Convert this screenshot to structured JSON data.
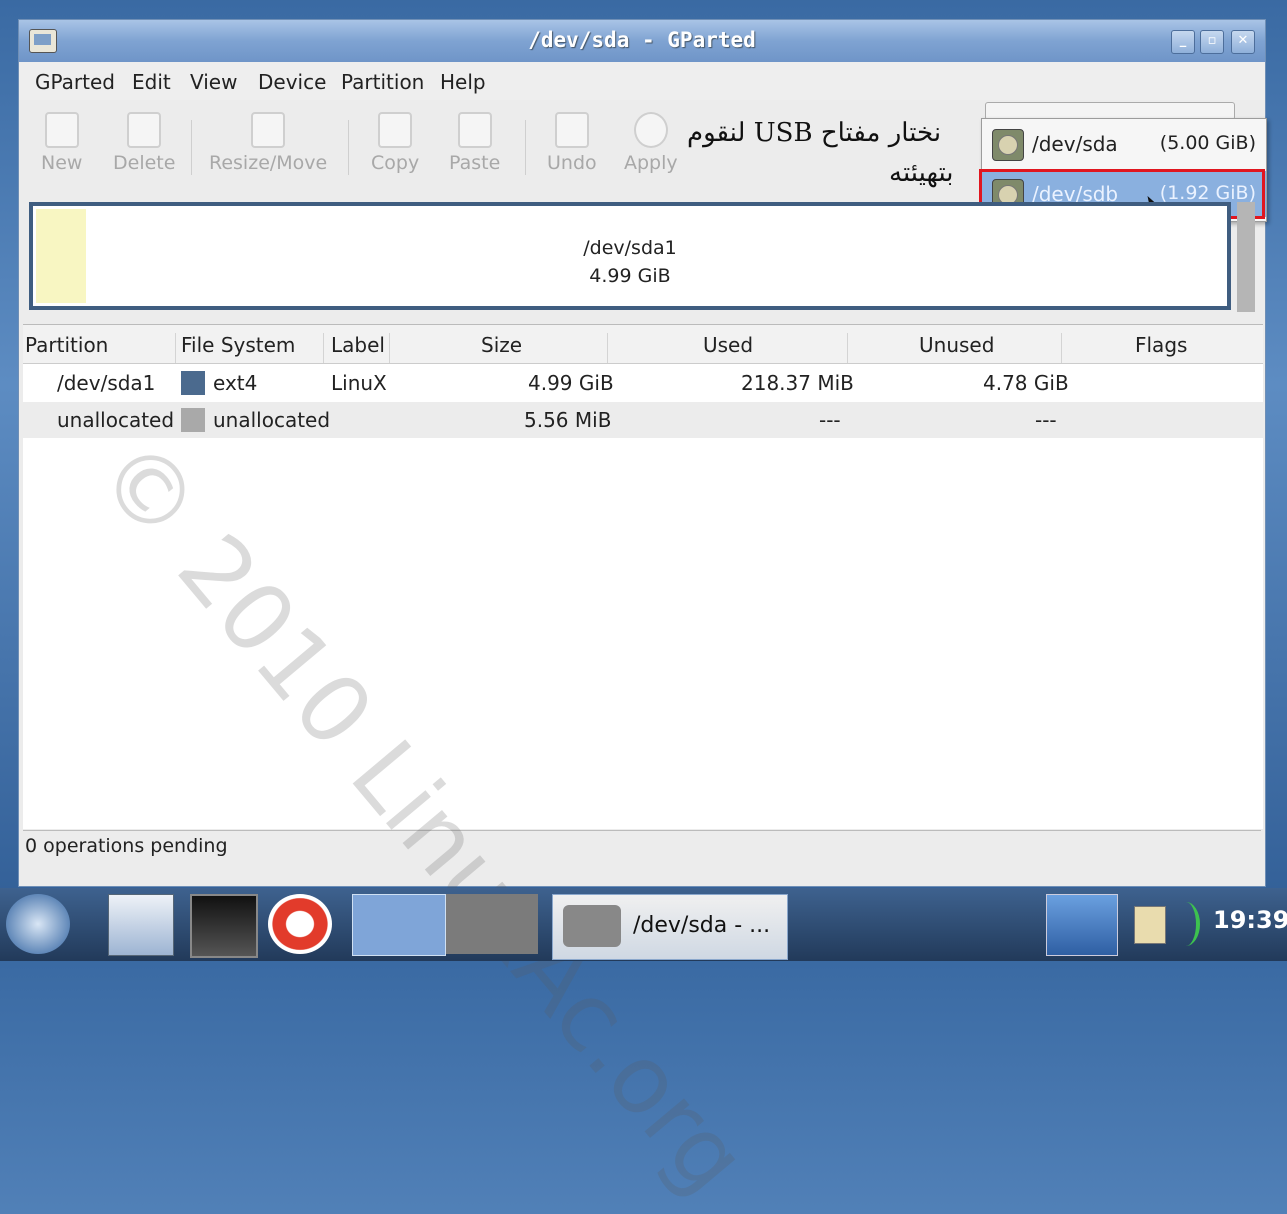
{
  "window": {
    "title": "/dev/sda - GParted"
  },
  "menubar": [
    {
      "label": "GParted",
      "ul": "G"
    },
    {
      "label": "Edit",
      "ul": "E"
    },
    {
      "label": "View",
      "ul": "V"
    },
    {
      "label": "Device",
      "ul": "D"
    },
    {
      "label": "Partition",
      "ul": "P"
    },
    {
      "label": "Help",
      "ul": "H"
    }
  ],
  "toolbar": {
    "new": "New",
    "delete": "Delete",
    "resize_move": "Resize/Move",
    "copy": "Copy",
    "paste": "Paste",
    "undo": "Undo",
    "apply": "Apply"
  },
  "annotation": {
    "line1": "نختار مفتاح USB لنقوم",
    "line2": "بتهيئته"
  },
  "device_menu": [
    {
      "name": "/dev/sda",
      "size": "(5.00 GiB)",
      "selected": false
    },
    {
      "name": "/dev/sdb",
      "size": "(1.92 GiB)",
      "selected": true
    }
  ],
  "disk_map": {
    "name": "/dev/sda1",
    "size": "4.99 GiB",
    "color": "#f8f6c2"
  },
  "table": {
    "headers": [
      "Partition",
      "File System",
      "Label",
      "Size",
      "Used",
      "Unused",
      "Flags"
    ],
    "rows": [
      {
        "partition": "/dev/sda1",
        "fs": "ext4",
        "fs_color": "#4b6a8e",
        "label": "LinuX",
        "size": "4.99 GiB",
        "used": "218.37 MiB",
        "unused": "4.78 GiB",
        "flags": ""
      },
      {
        "partition": "unallocated",
        "fs": "unallocated",
        "fs_color": "#a9a9a9",
        "label": "",
        "size": "5.56 MiB",
        "used": "---",
        "unused": "---",
        "flags": ""
      }
    ]
  },
  "status": {
    "text": "0 operations pending"
  },
  "watermark": "© 2010 LinuxAc.org",
  "taskbar": {
    "task_label": "/dev/sda - ...",
    "clock": "19:39"
  }
}
